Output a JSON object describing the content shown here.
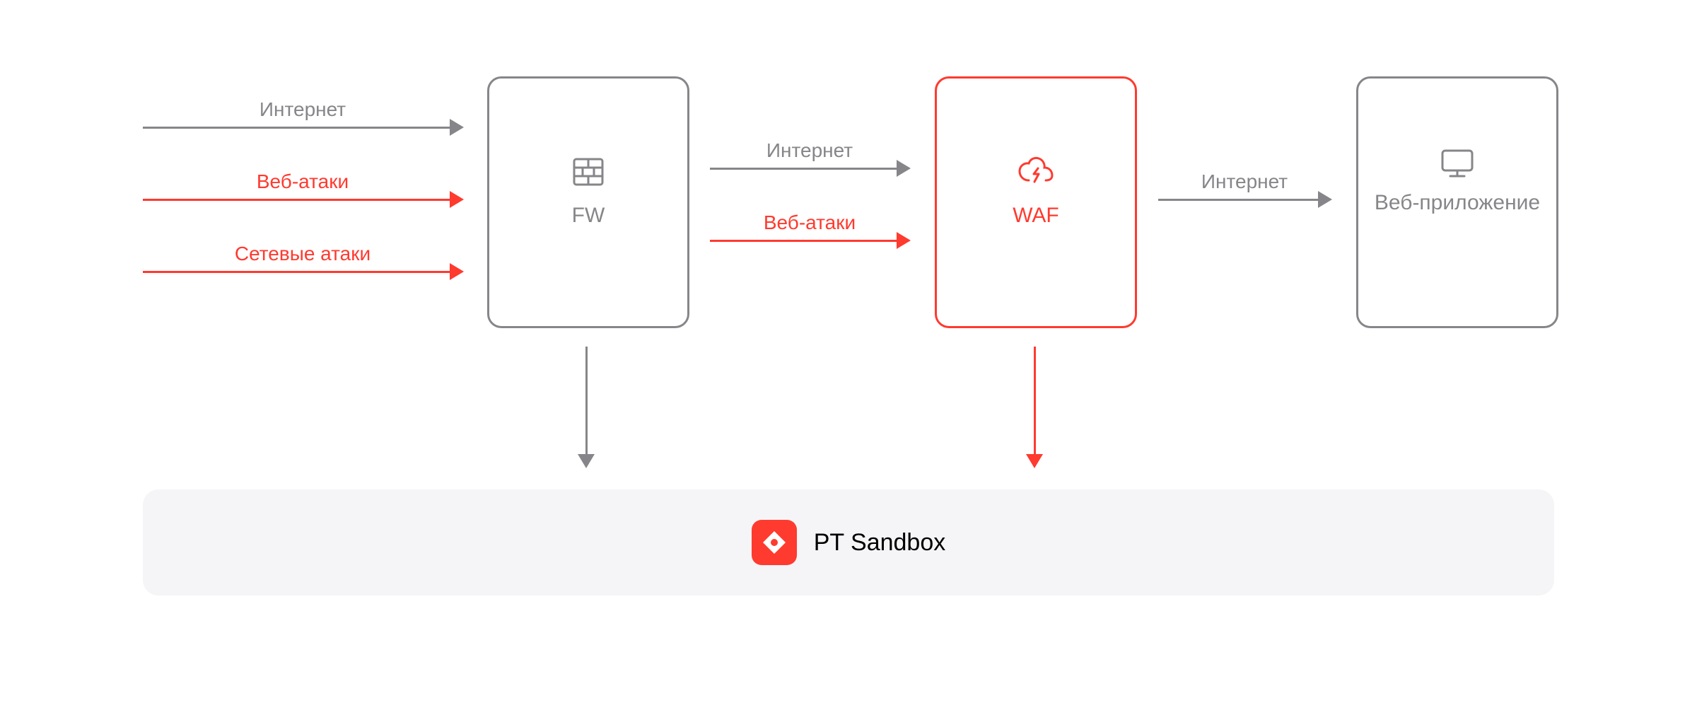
{
  "arrows": {
    "left_internet": "Интернет",
    "left_web_attacks": "Веб-атаки",
    "left_net_attacks": "Сетевые атаки",
    "mid_internet": "Интернет",
    "mid_web_attacks": "Веб-атаки",
    "right_internet": "Интернет"
  },
  "nodes": {
    "fw": {
      "label": "FW"
    },
    "waf": {
      "label": "WAF"
    },
    "app": {
      "label": "Веб-приложение"
    }
  },
  "sandbox": {
    "label": "PT Sandbox"
  },
  "colors": {
    "gray": "#86868a",
    "red": "#ff3a2f",
    "panel": "#f5f5f7"
  }
}
